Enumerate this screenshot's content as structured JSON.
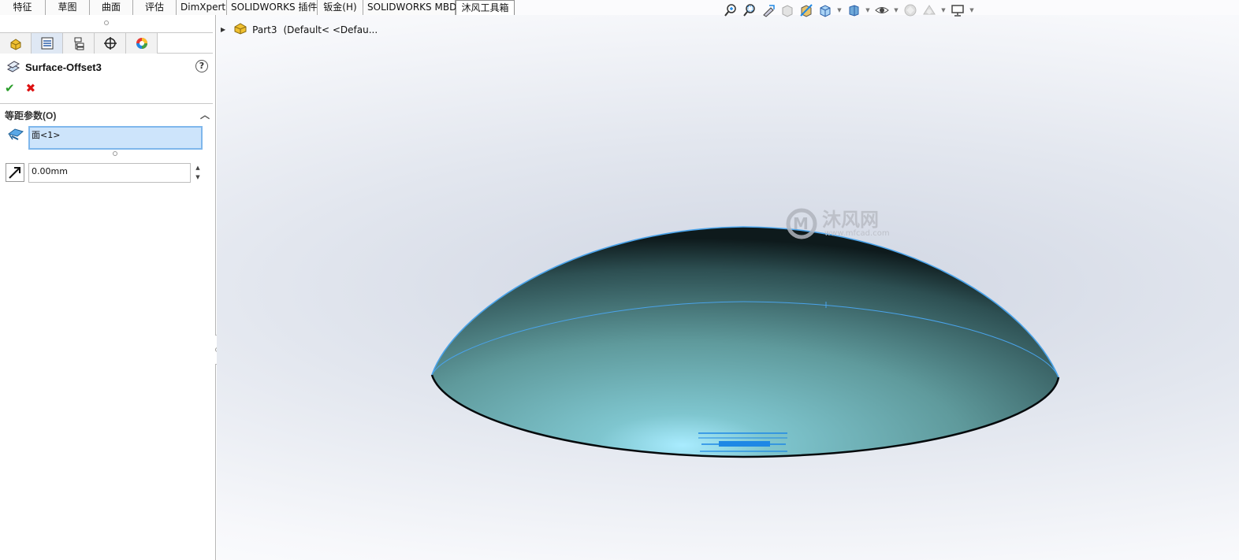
{
  "command_tabs": [
    "特征",
    "草图",
    "曲面",
    "评估",
    "DimXpert",
    "SOLIDWORKS 插件",
    "钣金(H)",
    "SOLIDWORKS MBD",
    "沐风工具箱"
  ],
  "active_tab_index": 8,
  "manager_tabs": [
    "featuremanager-icon",
    "propertymanager-icon",
    "configurationmanager-icon",
    "dimxpertmanager-icon",
    "displaymanager-icon"
  ],
  "property_manager": {
    "title": "Surface-Offset3",
    "help": "?",
    "ok": "✔",
    "cancel": "✖",
    "group_title": "等距参数(O)",
    "selection_value": "面<1>",
    "distance_value": "0.00mm"
  },
  "tree": {
    "part_name": "Part3",
    "config": "(Default< <Defau..."
  },
  "watermark": {
    "brand": "沐风网",
    "url": "www.mfcad.com"
  },
  "colors": {
    "accent": "#4aa3ea",
    "surface": "#6aa3a4",
    "selection_fill": "#cde4fb"
  }
}
